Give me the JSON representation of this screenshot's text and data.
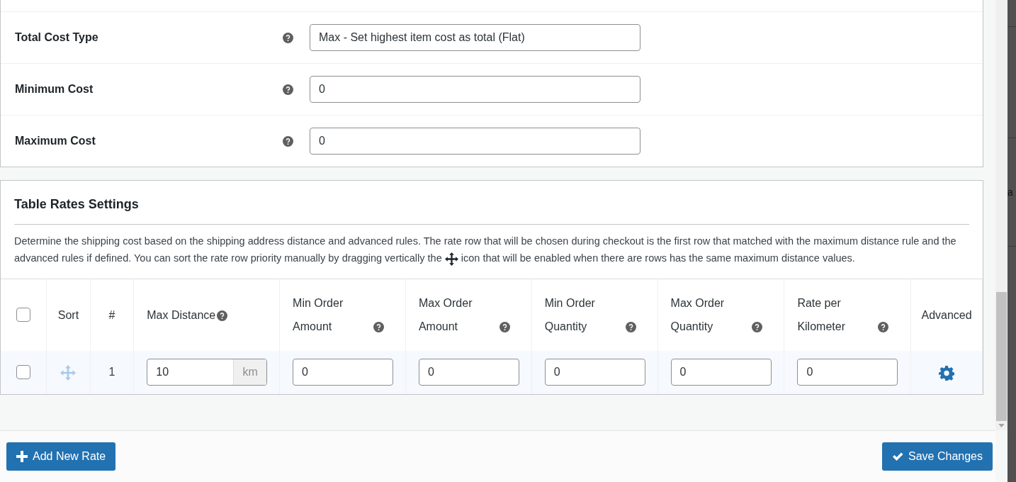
{
  "settings": [
    {
      "label": "Total Cost Type",
      "value": "Max - Set highest item cost as total (Flat)"
    },
    {
      "label": "Minimum Cost",
      "value": "0"
    },
    {
      "label": "Maximum Cost",
      "value": "0"
    }
  ],
  "table_rates": {
    "title": "Table Rates Settings",
    "description_before": "Determine the shipping cost based on the shipping address distance and advanced rules. The rate row that will be chosen during checkout is the first row that matched with the maximum distance rule and the advanced rules if defined. You can sort the rate row priority manually by dragging vertically the",
    "description_after": "icon that will be enabled when there are rows has the same maximum distance values.",
    "select_all": {
      "checked": false
    },
    "columns": [
      {
        "kind": "sort",
        "label": "Sort",
        "help": false
      },
      {
        "kind": "index",
        "label": "#",
        "help": false
      },
      {
        "kind": "distance",
        "label": "Max Distance",
        "help": true
      },
      {
        "kind": "input",
        "label": "Min Order Amount",
        "help": true
      },
      {
        "kind": "input",
        "label": "Max Order Amount",
        "help": true
      },
      {
        "kind": "input",
        "label": "Min Order Quantity",
        "help": true
      },
      {
        "kind": "input",
        "label": "Max Order Quantity",
        "help": true
      },
      {
        "kind": "input",
        "label": "Rate per Kilometer",
        "help": true
      },
      {
        "kind": "advanced",
        "label": "Advanced",
        "help": false
      }
    ],
    "rows": [
      {
        "selected": false,
        "number": "1",
        "max_distance": "10",
        "unit": "km",
        "values": [
          "0",
          "0",
          "0",
          "0",
          "0"
        ]
      }
    ]
  },
  "side_fragment": "a",
  "buttons": [
    {
      "kind": "add",
      "label": "Add New Rate"
    },
    {
      "kind": "save",
      "label": "Save Changes"
    }
  ]
}
